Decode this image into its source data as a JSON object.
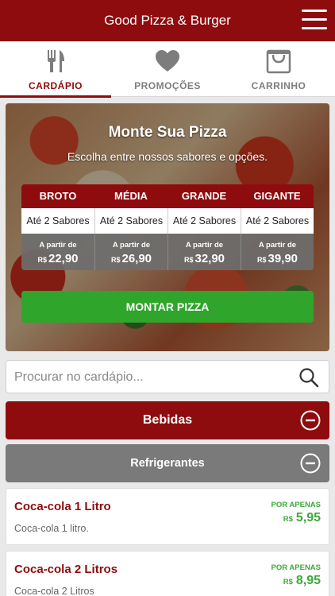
{
  "header": {
    "title": "Good Pizza & Burger"
  },
  "tabs": [
    {
      "label": "CARDÁPIO",
      "icon": "fork-knife-icon",
      "active": true
    },
    {
      "label": "PROMOÇÕES",
      "icon": "heart-icon",
      "active": false
    },
    {
      "label": "CARRINHO",
      "icon": "shopping-bag-icon",
      "active": false
    }
  ],
  "builder": {
    "title": "Monte Sua Pizza",
    "subtitle": "Escolha entre nossos sabores e opções.",
    "sizes": [
      {
        "name": "BROTO",
        "flavors": "Até 2 Sabores",
        "from": "A partir de",
        "currency": "R$",
        "price": "22,90"
      },
      {
        "name": "MÉDIA",
        "flavors": "Até 2 Sabores",
        "from": "A partir de",
        "currency": "R$",
        "price": "26,90"
      },
      {
        "name": "GRANDE",
        "flavors": "Até 2 Sabores",
        "from": "A partir de",
        "currency": "R$",
        "price": "32,90"
      },
      {
        "name": "GIGANTE",
        "flavors": "Até 2 Sabores",
        "from": "A partir de",
        "currency": "R$",
        "price": "39,90"
      }
    ],
    "button_label": "MONTAR PIZZA"
  },
  "search": {
    "placeholder": "Procurar no cardápio..."
  },
  "categories": {
    "main": {
      "label": "Bebidas"
    },
    "sub": {
      "label": "Refrigerantes"
    }
  },
  "products": [
    {
      "name": "Coca-cola 1 Litro",
      "description": "Coca-cola 1 litro.",
      "only_label": "POR APENAS",
      "currency": "R$",
      "price": "5,95"
    },
    {
      "name": "Coca-cola 2 Litros",
      "description": "Coca-cola 2 Litros",
      "only_label": "POR APENAS",
      "currency": "R$",
      "price": "8,95"
    }
  ],
  "colors": {
    "brand": "#8e0c0e",
    "accent_green": "#2fa52c",
    "price_green": "#3ea83a",
    "secondary_gray": "#7a7a7a"
  }
}
